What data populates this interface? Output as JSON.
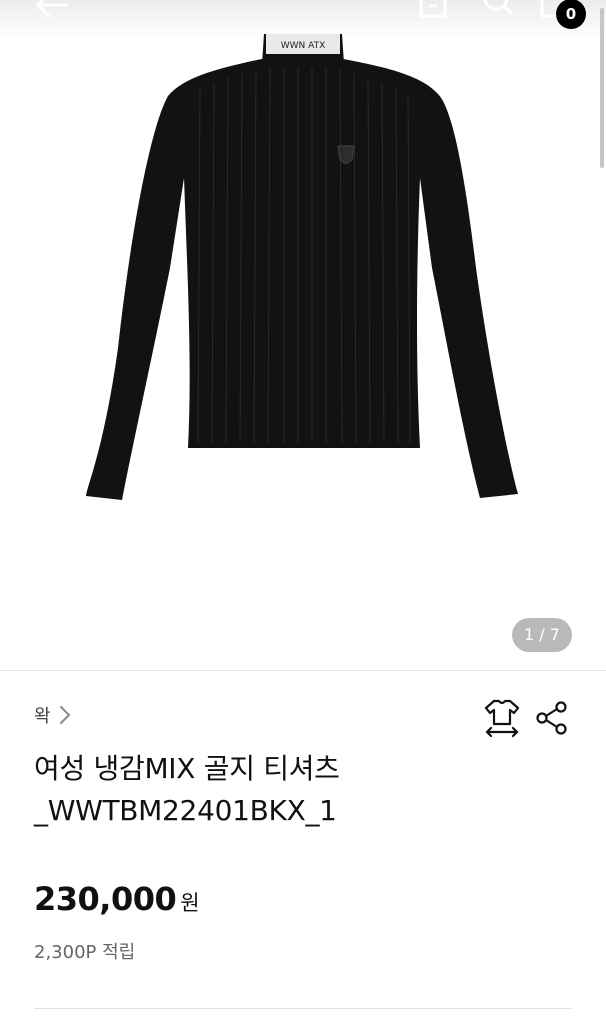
{
  "header": {
    "cart_count": "0"
  },
  "gallery": {
    "counter": "1 / 7",
    "neck_label": "WWN ATX"
  },
  "product": {
    "brand": "왁",
    "title_line1": "여성 냉감MIX 골지 티셔츠",
    "title_line2": "_WWTBM22401BKX_1",
    "price": "230,000",
    "currency": "원",
    "points": "2,300P 적립"
  },
  "icons": {
    "back": "back-arrow-icon",
    "share_top": "share-box-icon",
    "search": "search-icon",
    "cart": "cart-icon",
    "size_guide": "size-guide-shirt-icon",
    "share": "share-icon",
    "brand_chevron": "chevron-right-icon"
  },
  "colors": {
    "badge_bg": "#000000",
    "counter_bg": "#b9b9b9",
    "text_primary": "#111111",
    "text_secondary": "#666666"
  }
}
